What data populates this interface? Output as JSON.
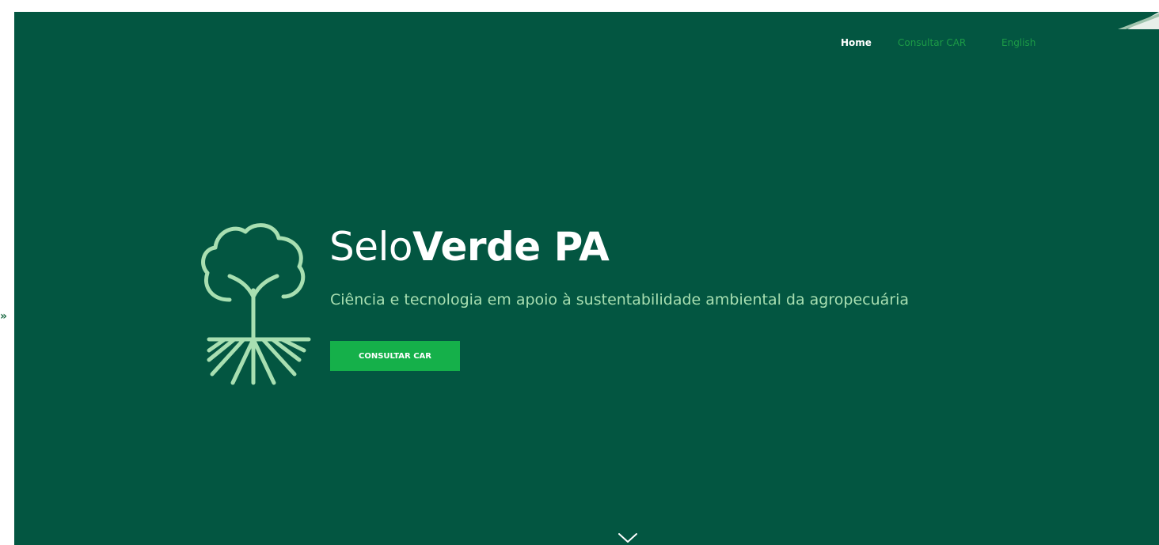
{
  "nav": {
    "home": "Home",
    "consultar_car": "Consultar CAR",
    "language": "English"
  },
  "hero": {
    "title_light": "Selo",
    "title_bold": "Verde PA",
    "subtitle": "Ciência e tecnologia em apoio à sustentabilidade ambiental da agropecuária",
    "cta_label": "CONSULTAR CAR"
  },
  "icons": {
    "logo": "tree-roots-icon",
    "scroll": "chevron-down-icon",
    "side": "double-chevron-right-icon"
  },
  "colors": {
    "background": "#035641",
    "accent": "#15b04a",
    "nav_link": "#1c9b46",
    "subtitle": "#a8dfb1",
    "logo_stroke": "#a8dfb1"
  }
}
